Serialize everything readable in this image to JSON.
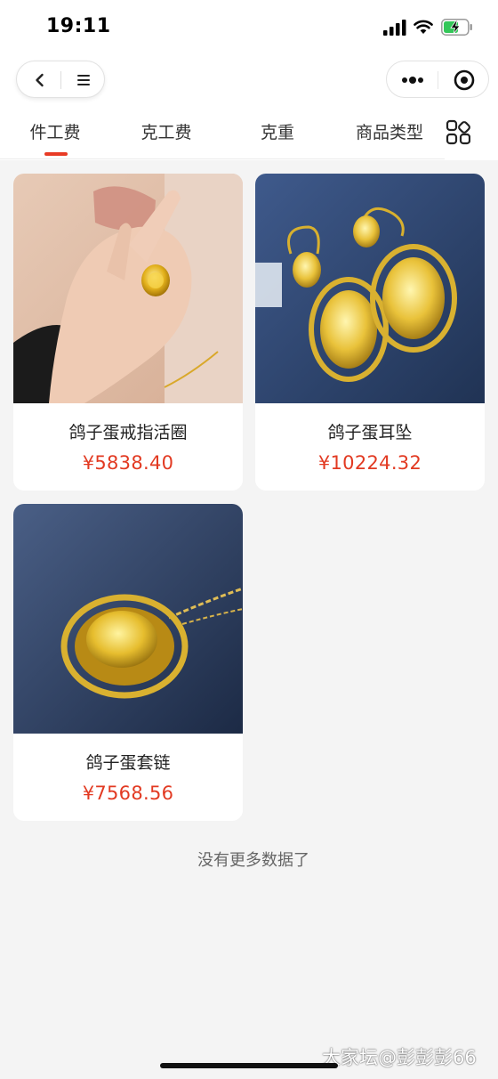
{
  "status_bar": {
    "time": "19:11"
  },
  "tabs": [
    {
      "label": "件工费",
      "active": true
    },
    {
      "label": "克工费",
      "active": false
    },
    {
      "label": "克重",
      "active": false
    },
    {
      "label": "商品类型",
      "active": false
    }
  ],
  "colors": {
    "accent": "#e83b25",
    "price": "#e23a22",
    "background": "#f4f4f4"
  },
  "products": [
    {
      "name": "鸽子蛋戒指活圈",
      "price": "¥5838.40",
      "image_icon": "gold-ring-on-hand"
    },
    {
      "name": "鸽子蛋耳坠",
      "price": "¥10224.32",
      "image_icon": "gold-earrings"
    },
    {
      "name": "鸽子蛋套链",
      "price": "¥7568.56",
      "image_icon": "gold-pendant-necklace"
    }
  ],
  "footer": {
    "no_more": "没有更多数据了"
  },
  "watermark": "大家坛@彭彭彭66"
}
